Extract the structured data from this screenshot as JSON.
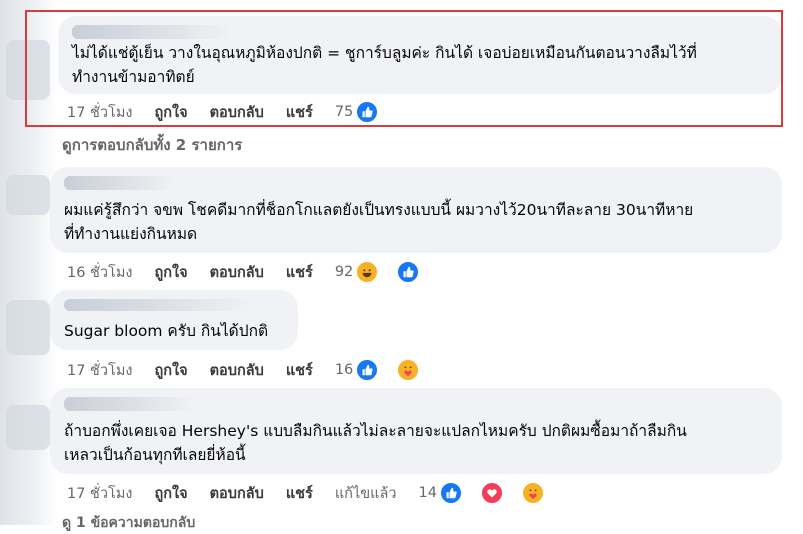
{
  "comments": [
    {
      "text": "ไม่ได้แช่ตู้เย็น วางในอุณหภูมิห้องปกติ = ชูการ์บลูมค่ะ กินได้ เจอบ่อยเหมือนกันตอนวางลืมไว้ที่\nทำงานข้ามอาทิตย์",
      "time": "17 ชั่วโมง",
      "like": "ถูกใจ",
      "reply": "ตอบกลับ",
      "share": "แชร์",
      "edited": "",
      "count": "75",
      "reactions": [
        "like"
      ]
    },
    {
      "text": "ผมแค่รู้สึกว่า จขพ โชคดีมากที่ช็อกโกแลตยังเป็นทรงแบบนี้ ผมวางไว้20นาทีละลาย 30นาทีหาย\nที่ทำงานแย่งกินหมด",
      "time": "16 ชั่วโมง",
      "like": "ถูกใจ",
      "reply": "ตอบกลับ",
      "share": "แชร์",
      "edited": "",
      "count": "92",
      "reactions": [
        "haha",
        "like"
      ]
    },
    {
      "text": "Sugar bloom ครับ กินได้ปกติ",
      "time": "17 ชั่วโมง",
      "like": "ถูกใจ",
      "reply": "ตอบกลับ",
      "share": "แชร์",
      "edited": "",
      "count": "16",
      "reactions": [
        "like",
        "care"
      ]
    },
    {
      "text": "ถ้าบอกพึ่งเคยเจอ Hershey's แบบลืมกินแล้วไม่ละลายจะแปลกไหมครับ ปกติผมซื้อมาถ้าลืมกิน\nเหลวเป็นก้อนทุกทีเลยยี่ห้อนี้",
      "time": "17 ชั่วโมง",
      "like": "ถูกใจ",
      "reply": "ตอบกลับ",
      "share": "แชร์",
      "edited": "แก้ไขแล้ว",
      "count": "14",
      "reactions": [
        "like",
        "love",
        "care"
      ]
    }
  ],
  "replies_link": "ดูการตอบกลับทั้ง 2 รายการ",
  "footer_partial": "ดู 1 ข้อความตอบกลับ",
  "colors": {
    "bubble": "#f0f2f5",
    "highlight": "#d83b3b",
    "like": "#1877f2"
  }
}
